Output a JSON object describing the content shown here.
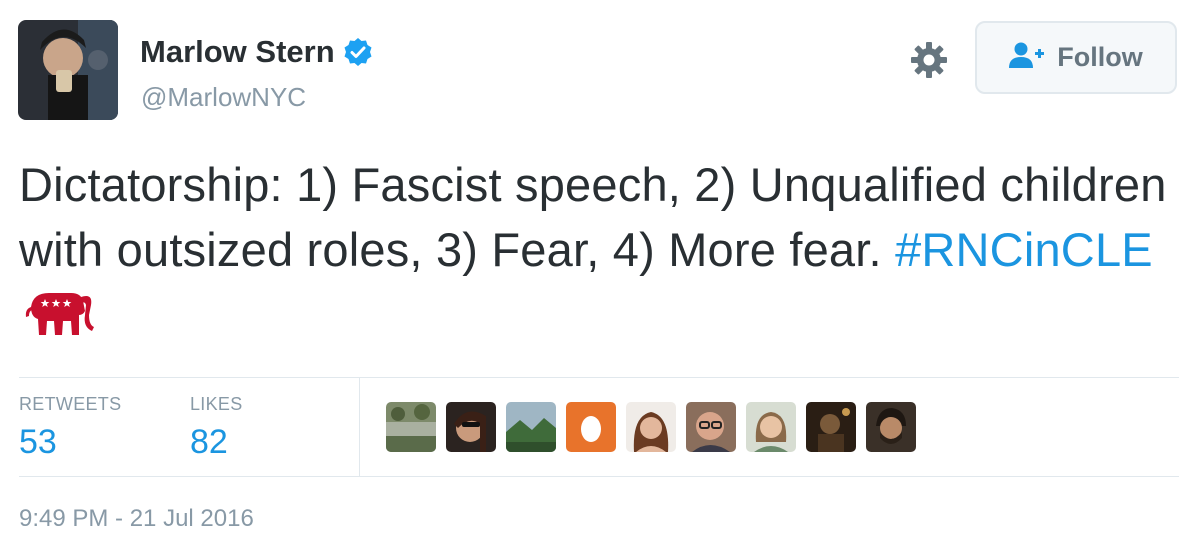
{
  "author": {
    "name": "Marlow Stern",
    "handle": "@MarlowNYC",
    "verified": true,
    "avatar_icon": "profile-photo"
  },
  "header": {
    "settings_icon": "gear-icon",
    "follow_label": "Follow",
    "follow_icon": "add-user-icon"
  },
  "tweet": {
    "text": "Dictatorship: 1) Fascist speech, 2) Unqualified children with outsized roles, 3) Fear, 4) More fear.",
    "hashtag": "#RNCinCLE",
    "hashflag_icon": "gop-elephant-icon"
  },
  "stats": {
    "retweets_label": "RETWEETS",
    "retweets_value": "53",
    "likes_label": "LIKES",
    "likes_value": "82"
  },
  "likers_count_shown": 9,
  "timestamp": "9:49 PM - 21 Jul 2016",
  "colors": {
    "link_blue": "#1b95e0",
    "text": "#292f33",
    "muted": "#8899a6",
    "verified_blue": "#1da1f2",
    "elephant_red": "#c8102e",
    "egg_orange": "#e8732b"
  }
}
